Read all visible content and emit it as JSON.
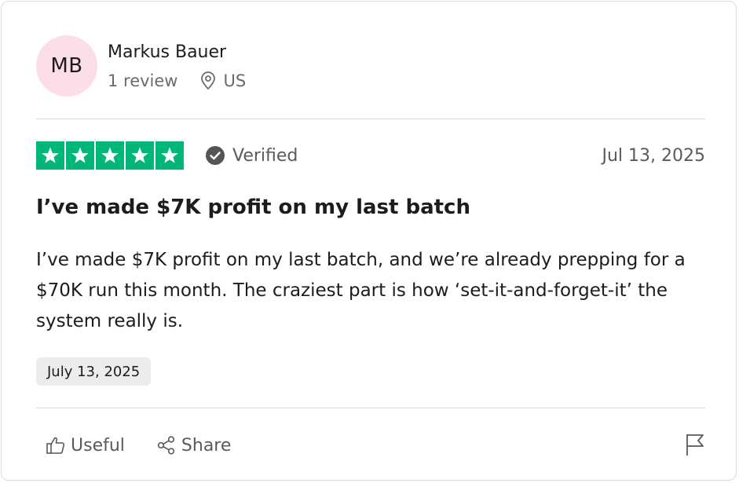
{
  "reviewer": {
    "initials": "MB",
    "name": "Markus Bauer",
    "review_count": "1 review",
    "country": "US",
    "avatar_color": "#fcdfe6"
  },
  "rating": {
    "stars": 5,
    "max_stars": 5,
    "star_color": "#00b67a",
    "verified_label": "Verified",
    "date": "Jul 13, 2025"
  },
  "review": {
    "title": "I’ve made $7K profit on my last batch",
    "body": "I’ve made $7K profit on my last batch, and we’re already prepping for a $70K run this month. The craziest part is how ‘set-it-and-forget-it’ the system really is.",
    "experience_date": "July 13, 2025"
  },
  "actions": {
    "useful_label": "Useful",
    "share_label": "Share",
    "useful_icon": "thumbs-up-icon",
    "share_icon": "share-icon",
    "report_icon": "flag-icon"
  }
}
